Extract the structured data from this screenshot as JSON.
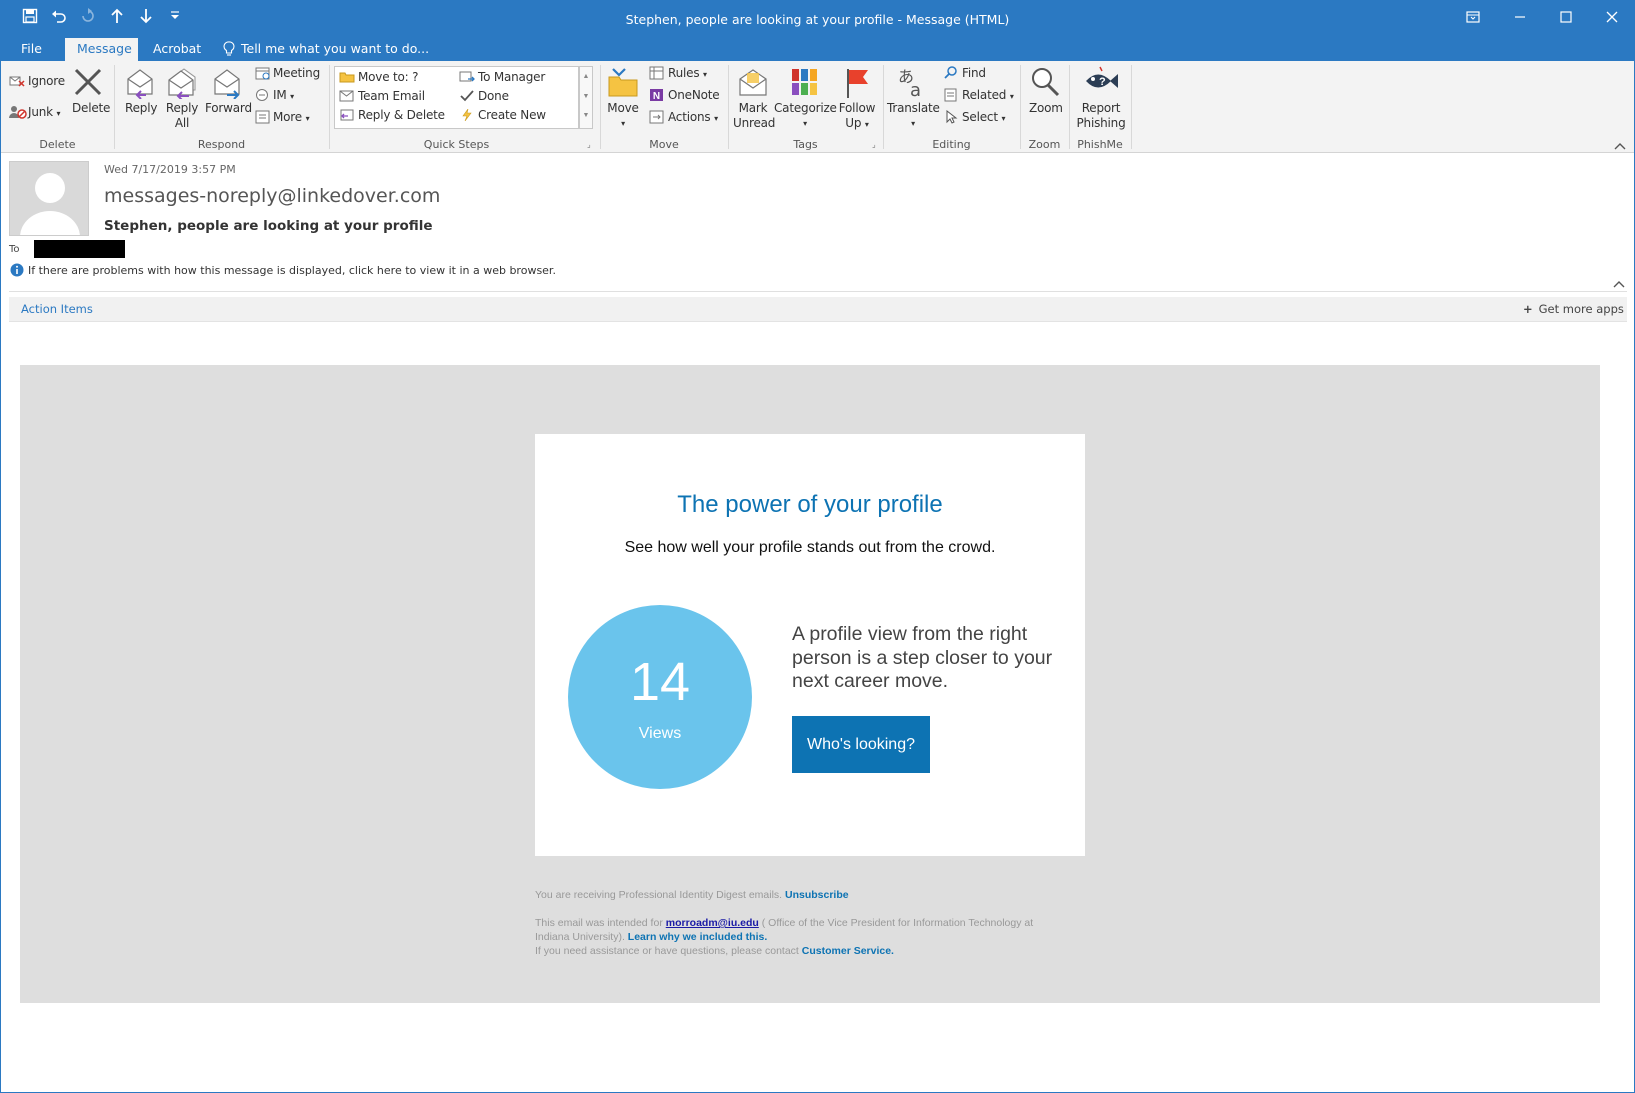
{
  "window": {
    "title": "Stephen, people are looking at your profile - Message (HTML)"
  },
  "tabs": [
    {
      "label": "File"
    },
    {
      "label": "Message"
    },
    {
      "label": "Acrobat"
    }
  ],
  "tell_me": "Tell me what you want to do...",
  "ribbon": {
    "delete_group": {
      "label": "Delete",
      "ignore": "Ignore",
      "junk": "Junk",
      "delete": "Delete"
    },
    "respond_group": {
      "label": "Respond",
      "reply": "Reply",
      "reply_all_1": "Reply",
      "reply_all_2": "All",
      "forward": "Forward",
      "meeting": "Meeting",
      "im": "IM",
      "more": "More"
    },
    "quick_steps": {
      "label": "Quick Steps",
      "items": [
        "Move to: ?",
        "Team Email",
        "Reply & Delete",
        "To Manager",
        "Done",
        "Create New"
      ]
    },
    "move_group": {
      "label": "Move",
      "move": "Move",
      "rules": "Rules",
      "onenote": "OneNote",
      "actions": "Actions"
    },
    "tags_group": {
      "label": "Tags",
      "mark_unread_1": "Mark",
      "mark_unread_2": "Unread",
      "categorize": "Categorize",
      "follow_up_1": "Follow",
      "follow_up_2": "Up"
    },
    "editing_group": {
      "label": "Editing",
      "translate": "Translate",
      "find": "Find",
      "related": "Related",
      "select": "Select"
    },
    "zoom_group": {
      "label": "Zoom",
      "zoom": "Zoom"
    },
    "phishme_group": {
      "label": "PhishMe",
      "report_1": "Report",
      "report_2": "Phishing"
    }
  },
  "message": {
    "date": "Wed 7/17/2019 3:57 PM",
    "from": "messages-noreply@linkedover.com",
    "subject": "Stephen, people are looking at your profile",
    "to_label": "To",
    "info": "If there are problems with how this message is displayed, click here to view it in a web browser.",
    "action_items": "Action Items",
    "get_more_apps": "Get more apps"
  },
  "email": {
    "heading": "The power of your profile",
    "subheading": "See how well your profile stands out from the crowd.",
    "views_count": "14",
    "views_label": "Views",
    "pitch_line1": "A profile view from the right",
    "pitch_line2": "person is a step closer to your",
    "pitch_line3": "next career move.",
    "cta": "Who's looking?",
    "footer": {
      "receiving": "You are receiving Professional Identity Digest emails.",
      "unsubscribe": "Unsubscribe",
      "intended_prefix": "This email was intended for",
      "intended_email": "morroadm@iu.edu",
      "intended_org_1": "( Office of the Vice President for Information Technology at",
      "intended_org_2": "Indiana University).",
      "learn_why": "Learn why we included this.",
      "assistance": "If you need assistance or have questions, please contact",
      "customer_service": "Customer Service."
    }
  },
  "colors": {
    "accent": "#2b79c2",
    "email_blue": "#0d73b3",
    "circle": "#6ac4ec",
    "email_bg": "#dedede"
  }
}
